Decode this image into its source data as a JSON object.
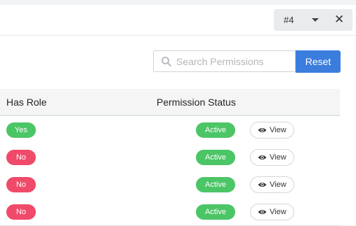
{
  "tab": {
    "number": "#4"
  },
  "search": {
    "placeholder": "Search Permissions",
    "value": ""
  },
  "reset_label": "Reset",
  "table": {
    "headers": [
      "Has Role",
      "Permission Status"
    ],
    "rows": [
      {
        "has_role": "Yes",
        "status": "Active",
        "action": "View"
      },
      {
        "has_role": "No",
        "status": "Active",
        "action": "View"
      },
      {
        "has_role": "No",
        "status": "Active",
        "action": "View"
      },
      {
        "has_role": "No",
        "status": "Active",
        "action": "View"
      }
    ]
  },
  "colors": {
    "primary": "#3b7ddd",
    "success": "#4cc566",
    "danger": "#f04a6a"
  },
  "icons": [
    "chevron-down-icon",
    "close-icon",
    "search-icon",
    "eye-icon"
  ]
}
